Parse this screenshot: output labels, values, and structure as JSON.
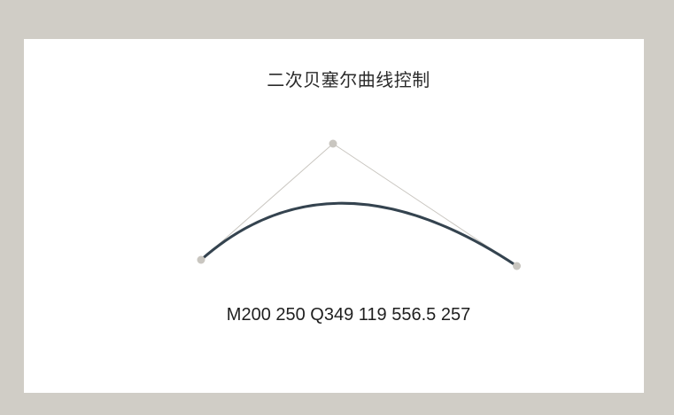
{
  "title": "二次贝塞尔曲线控制",
  "path_text": "M200 250 Q349 119 556.5 257",
  "colors": {
    "background": "#d0cdc6",
    "card": "#ffffff",
    "curve": "#34434f",
    "guide": "#c9c6c0",
    "handle": "#c9c6c0"
  },
  "icons": {
    "handle": "circle-handle-icon"
  }
}
